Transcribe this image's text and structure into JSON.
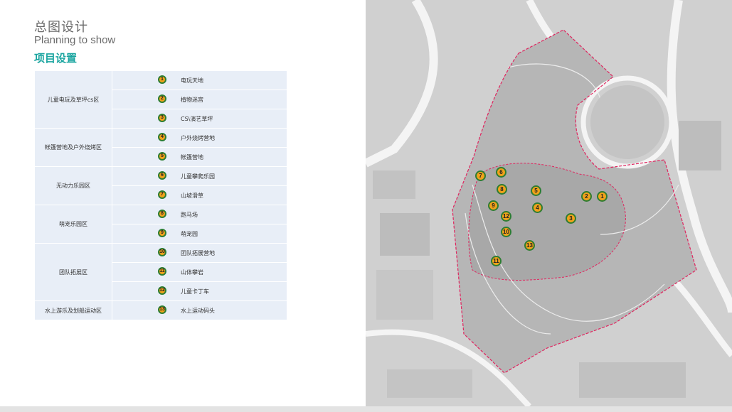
{
  "header": {
    "title_cn": "总图设计",
    "title_en": "Planning to show",
    "subtitle": "项目设置"
  },
  "zones": [
    {
      "name": "儿童电玩及草坪cs区",
      "items": [
        {
          "no": "1",
          "label": "电玩天地"
        },
        {
          "no": "2",
          "label": "植物迷宫"
        },
        {
          "no": "3",
          "label": "CS\\演艺草坪"
        }
      ]
    },
    {
      "name": "帐篷营地及户外烧烤区",
      "items": [
        {
          "no": "4",
          "label": "户外烧烤营地"
        },
        {
          "no": "5",
          "label": "帐篷营地"
        }
      ]
    },
    {
      "name": "无动力乐园区",
      "items": [
        {
          "no": "6",
          "label": "儿童攀爬乐园"
        },
        {
          "no": "7",
          "label": "山坡滑草"
        }
      ]
    },
    {
      "name": "萌宠乐园区",
      "items": [
        {
          "no": "8",
          "label": "跑马场"
        },
        {
          "no": "9",
          "label": "萌宠园"
        }
      ]
    },
    {
      "name": "团队拓展区",
      "items": [
        {
          "no": "10",
          "label": "团队拓展营地"
        },
        {
          "no": "11",
          "label": "山体攀岩"
        },
        {
          "no": "12",
          "label": "儿童卡丁车"
        }
      ]
    },
    {
      "name": "水上游乐及划船运动区",
      "items": [
        {
          "no": "13",
          "label": "水上运动码头"
        }
      ]
    }
  ],
  "map_markers": [
    "1",
    "2",
    "3",
    "4",
    "5",
    "6",
    "7",
    "8",
    "9",
    "10",
    "11",
    "12",
    "13"
  ],
  "colors": {
    "accent": "#1aa5a0",
    "badge_fill": "#f0a21a",
    "badge_ring": "#2e7d32",
    "boundary": "#e0245e",
    "table_bg": "#e8eef7"
  }
}
